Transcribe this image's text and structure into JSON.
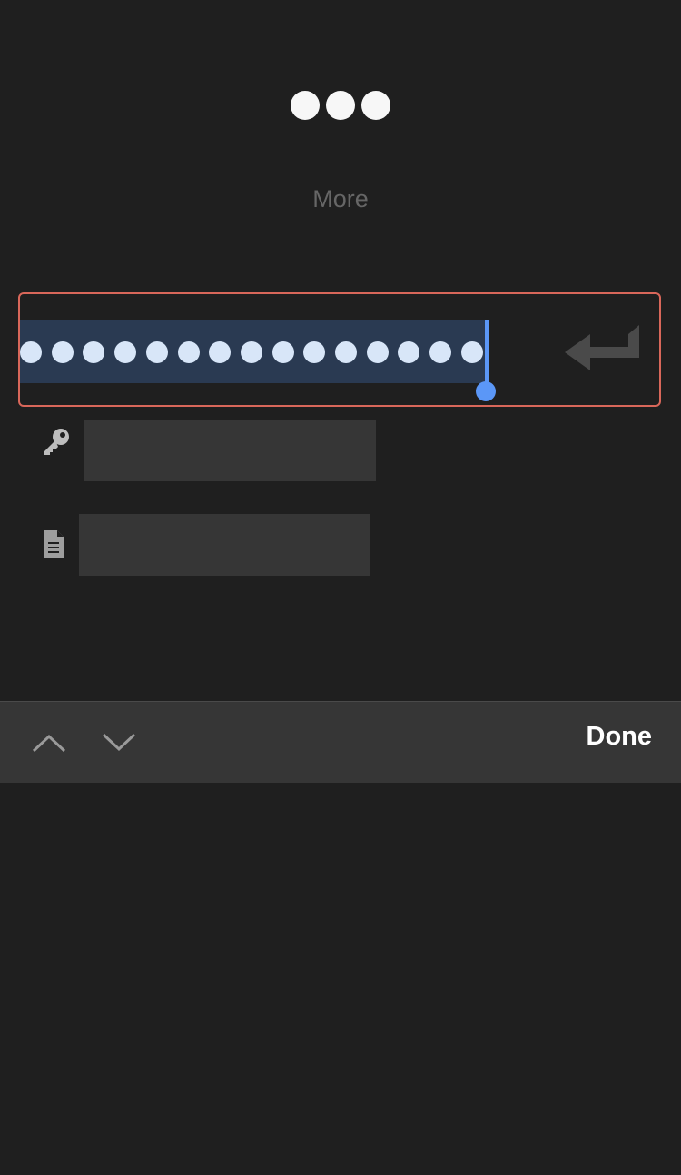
{
  "header": {
    "icon": "more-icon",
    "label": "More"
  },
  "password_field": {
    "masked_dot_count": 15,
    "selected": true,
    "return_icon": "return-arrow-icon"
  },
  "fields": [
    {
      "icon": "key-icon",
      "value": ""
    },
    {
      "icon": "document-icon",
      "value": ""
    }
  ],
  "keyboard_toolbar": {
    "prev_icon": "chevron-up-icon",
    "next_icon": "chevron-down-icon",
    "done_label": "Done"
  },
  "colors": {
    "background": "#1f1f1f",
    "focus_border": "#d9675a",
    "selection": "#2a3a52",
    "caret": "#5b97f7",
    "field_box": "#363636",
    "toolbar": "#363636"
  }
}
